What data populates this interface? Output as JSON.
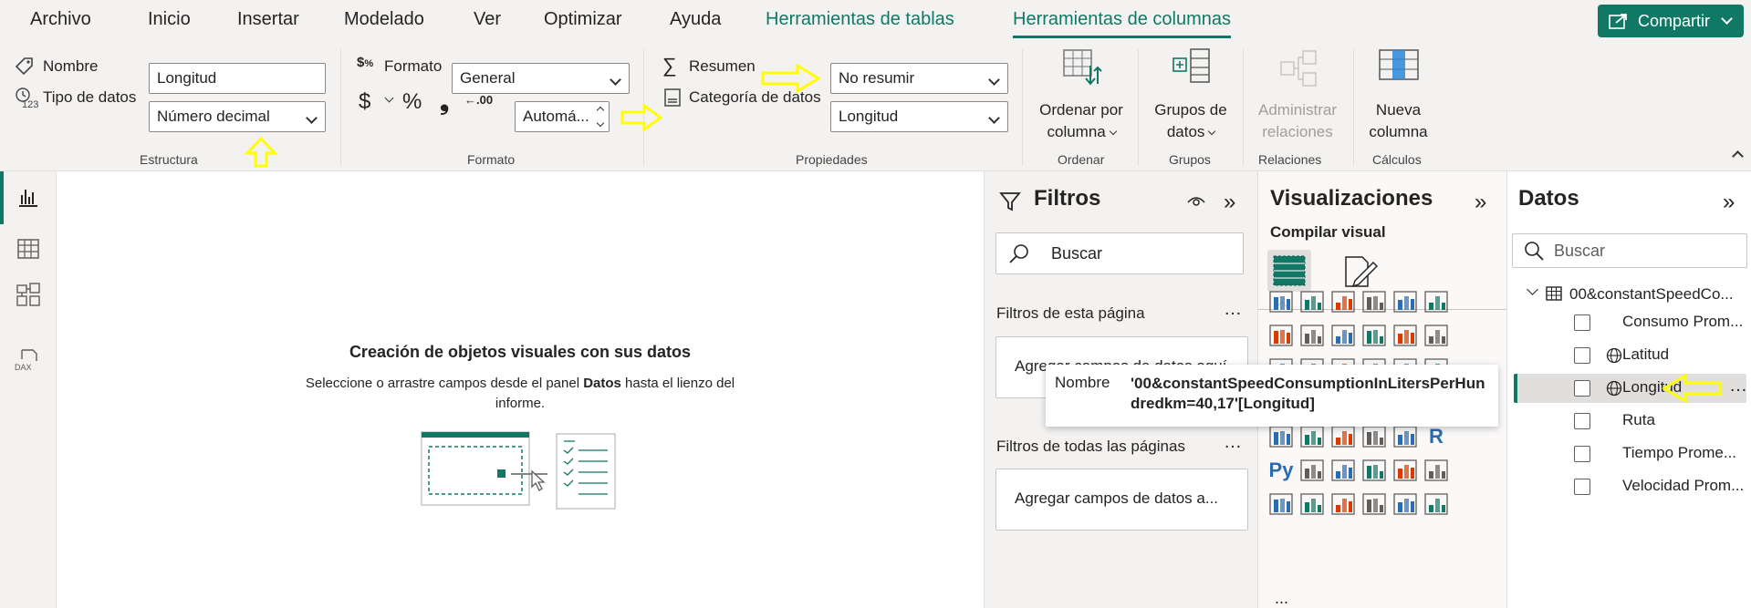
{
  "menu": {
    "tabs": [
      "Archivo",
      "Inicio",
      "Insertar",
      "Modelado",
      "Ver",
      "Optimizar",
      "Ayuda",
      "Herramientas de tablas",
      "Herramientas de columnas"
    ],
    "share": "Compartir"
  },
  "ribbon": {
    "estructura": {
      "nombre_label": "Nombre",
      "nombre_value": "Longitud",
      "tipo_label": "Tipo de datos",
      "tipo_value": "Número decimal",
      "group": "Estructura"
    },
    "formato": {
      "formato_label": "Formato",
      "formato_value": "General",
      "currency": "$",
      "percent": "%",
      "comma": "❟",
      "decimals_icon": "←.00",
      "auto_value": "Automá...",
      "group": "Formato"
    },
    "propiedades": {
      "resumen_label": "Resumen",
      "resumen_value": "No resumir",
      "categoria_label": "Categoría de datos",
      "categoria_value": "Longitud",
      "group": "Propiedades"
    },
    "ordenar": {
      "label1": "Ordenar por",
      "label2": "columna",
      "group": "Ordenar"
    },
    "grupos": {
      "label1": "Grupos de",
      "label2": "datos",
      "group": "Grupos"
    },
    "relaciones": {
      "label1": "Administrar",
      "label2": "relaciones",
      "group": "Relaciones"
    },
    "calculos": {
      "label1": "Nueva",
      "label2": "columna",
      "group": "Cálculos"
    }
  },
  "canvas": {
    "title": "Creación de objetos visuales con sus datos",
    "desc_pre": "Seleccione o arrastre campos desde el panel ",
    "desc_bold": "Datos",
    "desc_post": " hasta el lienzo del",
    "desc_line2": "informe."
  },
  "filters": {
    "title": "Filtros",
    "search_placeholder": "Buscar",
    "page_section": "Filtros de esta página",
    "page_add": "Agregar campos de datos aquí",
    "all_section": "Filtros de todas las páginas",
    "all_add": "Agregar campos de datos a..."
  },
  "viz": {
    "title": "Visualizaciones",
    "build": "Compilar visual",
    "more": "..."
  },
  "datos": {
    "title": "Datos",
    "search_placeholder": "Buscar",
    "table": "00&constantSpeedCo...",
    "fields": [
      {
        "label": "Consumo Prom...",
        "geo": false
      },
      {
        "label": "Latitud",
        "geo": true
      },
      {
        "label": "Longitud",
        "geo": true
      },
      {
        "label": "Ruta",
        "geo": false
      },
      {
        "label": "Tiempo Prome...",
        "geo": false
      },
      {
        "label": "Velocidad Prom...",
        "geo": false
      }
    ]
  },
  "tooltip": {
    "key": "Nombre",
    "value_line1": "'00&constantSpeedConsumptionInLitersPerHun",
    "value_line2": "dredkm=40,17'[Longitud]"
  },
  "colors": {
    "accent": "#117865",
    "highlight_arrow": "#ffff00"
  }
}
